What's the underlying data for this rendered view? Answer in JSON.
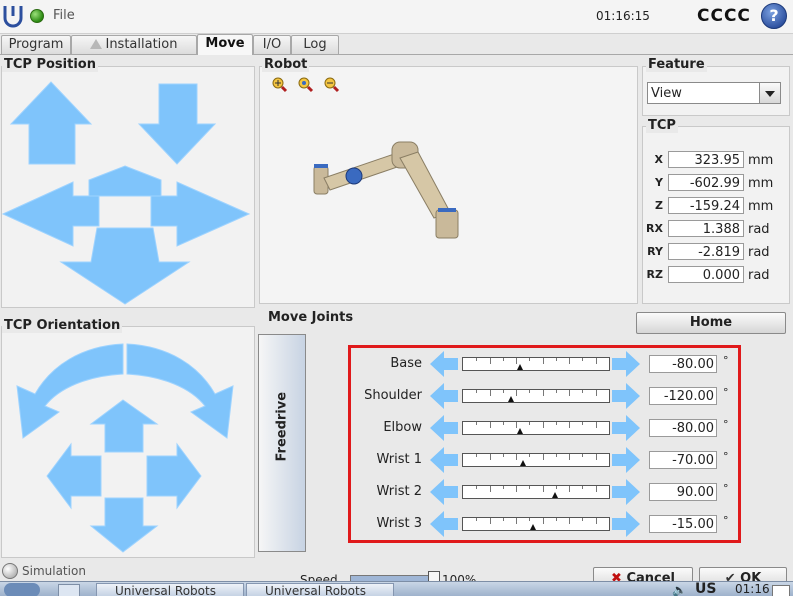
{
  "header": {
    "file_label": "File",
    "clock": "01:16:15",
    "robot_name": "CCCC",
    "help_label": "?"
  },
  "tabs": [
    {
      "label": "Program"
    },
    {
      "label": "Installation"
    },
    {
      "label": "Move",
      "active": true
    },
    {
      "label": "I/O"
    },
    {
      "label": "Log"
    }
  ],
  "tcp_position": {
    "title": "TCP Position"
  },
  "tcp_orientation": {
    "title": "TCP Orientation"
  },
  "robot_view": {
    "title": "Robot"
  },
  "feature": {
    "title": "Feature",
    "selected": "View"
  },
  "tcp": {
    "title": "TCP",
    "rows": [
      {
        "label": "X",
        "value": "323.95",
        "unit": "mm"
      },
      {
        "label": "Y",
        "value": "-602.99",
        "unit": "mm"
      },
      {
        "label": "Z",
        "value": "-159.24",
        "unit": "mm"
      },
      {
        "label": "RX",
        "value": "1.388",
        "unit": "rad"
      },
      {
        "label": "RY",
        "value": "-2.819",
        "unit": "rad"
      },
      {
        "label": "RZ",
        "value": "0.000",
        "unit": "rad"
      }
    ]
  },
  "home_label": "Home",
  "move_joints": {
    "title": "Move Joints",
    "freedrive_label": "Freedrive",
    "unit": "°",
    "joints": [
      {
        "name": "Base",
        "value": "-80.00",
        "position": 0.39
      },
      {
        "name": "Shoulder",
        "value": "-120.00",
        "position": 0.33
      },
      {
        "name": "Elbow",
        "value": "-80.00",
        "position": 0.39
      },
      {
        "name": "Wrist 1",
        "value": "-70.00",
        "position": 0.41
      },
      {
        "name": "Wrist 2",
        "value": "90.00",
        "position": 0.63
      },
      {
        "name": "Wrist 3",
        "value": "-15.00",
        "position": 0.48
      }
    ]
  },
  "footer": {
    "simulation_label": "Simulation",
    "speed_label": "Speed",
    "speed_value": "100%",
    "speed_fraction": 1.0,
    "cancel_label": "Cancel",
    "ok_label": "OK"
  },
  "taskbar": {
    "task1": "Universal Robots",
    "task2": "Universal Robots",
    "keyboard": "US",
    "clock": "01:16"
  },
  "colors": {
    "arrow": "#7fc4fb",
    "highlight": "#e0191b",
    "accent": "#2c4f9e"
  }
}
